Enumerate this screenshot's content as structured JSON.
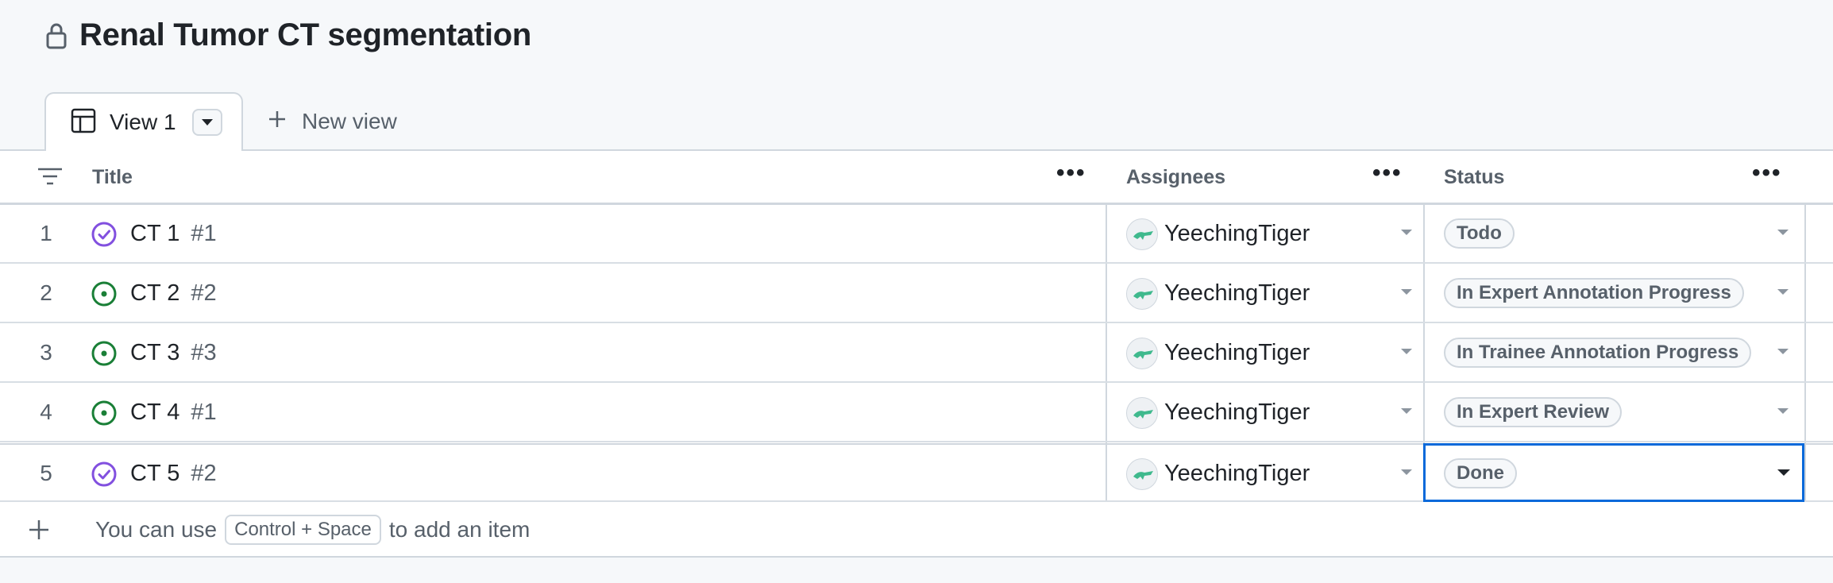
{
  "project": {
    "title": "Renal Tumor CT segmentation"
  },
  "tabs": {
    "active_label": "View 1",
    "new_view_label": "New view"
  },
  "columns": {
    "title": "Title",
    "assignees": "Assignees",
    "status": "Status"
  },
  "rows": [
    {
      "index": "1",
      "title": "CT 1",
      "issue_number": "#1",
      "state": "closed",
      "assignee": "YeechingTiger",
      "status": "Todo"
    },
    {
      "index": "2",
      "title": "CT 2",
      "issue_number": "#2",
      "state": "open",
      "assignee": "YeechingTiger",
      "status": "In Expert Annotation Progress"
    },
    {
      "index": "3",
      "title": "CT 3",
      "issue_number": "#3",
      "state": "open",
      "assignee": "YeechingTiger",
      "status": "In Trainee Annotation Progress"
    },
    {
      "index": "4",
      "title": "CT 4",
      "issue_number": "#1",
      "state": "open",
      "assignee": "YeechingTiger",
      "status": "In Expert Review"
    },
    {
      "index": "5",
      "title": "CT 5",
      "issue_number": "#2",
      "state": "closed",
      "assignee": "YeechingTiger",
      "status": "Done"
    }
  ],
  "add_item": {
    "prefix": "You can use",
    "shortcut": "Control + Space",
    "suffix": "to add an item"
  },
  "colors": {
    "open": "#1a7f37",
    "closed": "#8250df",
    "selection": "#0969da",
    "avatar_accent": "#3fb98d"
  }
}
